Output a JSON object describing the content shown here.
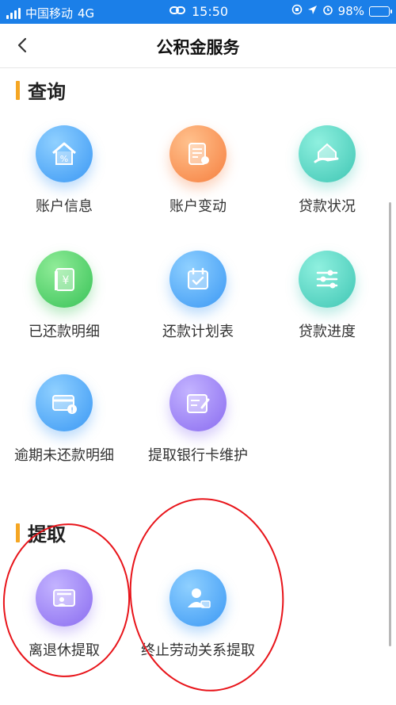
{
  "status_bar": {
    "carrier": "中国移动",
    "network": "4G",
    "time": "15:50",
    "battery": "98%"
  },
  "nav": {
    "title": "公积金服务",
    "back_icon": "chevron-left-icon"
  },
  "sections": [
    {
      "title": "查询",
      "items": [
        {
          "label": "账户信息",
          "icon": "house-percent-icon",
          "color": "#3b98f4"
        },
        {
          "label": "账户变动",
          "icon": "document-edit-icon",
          "color": "#f67f3f"
        },
        {
          "label": "贷款状况",
          "icon": "house-hand-icon",
          "color": "#3fc6b4"
        },
        {
          "label": "已还款明细",
          "icon": "yuan-ledger-icon",
          "color": "#38c257"
        },
        {
          "label": "还款计划表",
          "icon": "calendar-check-icon",
          "color": "#3b98f4"
        },
        {
          "label": "贷款进度",
          "icon": "sliders-icon",
          "color": "#3fc6b4"
        },
        {
          "label": "逾期未还款明细",
          "icon": "card-warning-icon",
          "color": "#3b98f4"
        },
        {
          "label": "提取银行卡维护",
          "icon": "card-edit-icon",
          "color": "#8a6cf0"
        }
      ]
    },
    {
      "title": "提取",
      "items": [
        {
          "label": "离退休提取",
          "icon": "retire-card-icon",
          "color": "#8a6cf0"
        },
        {
          "label": "终止劳动关系提取",
          "icon": "person-card-icon",
          "color": "#3b98f4"
        }
      ]
    }
  ],
  "colors": {
    "status_bar": "#1b7fe8",
    "section_accent": "#f5a623",
    "annotation": "#e8141a"
  }
}
